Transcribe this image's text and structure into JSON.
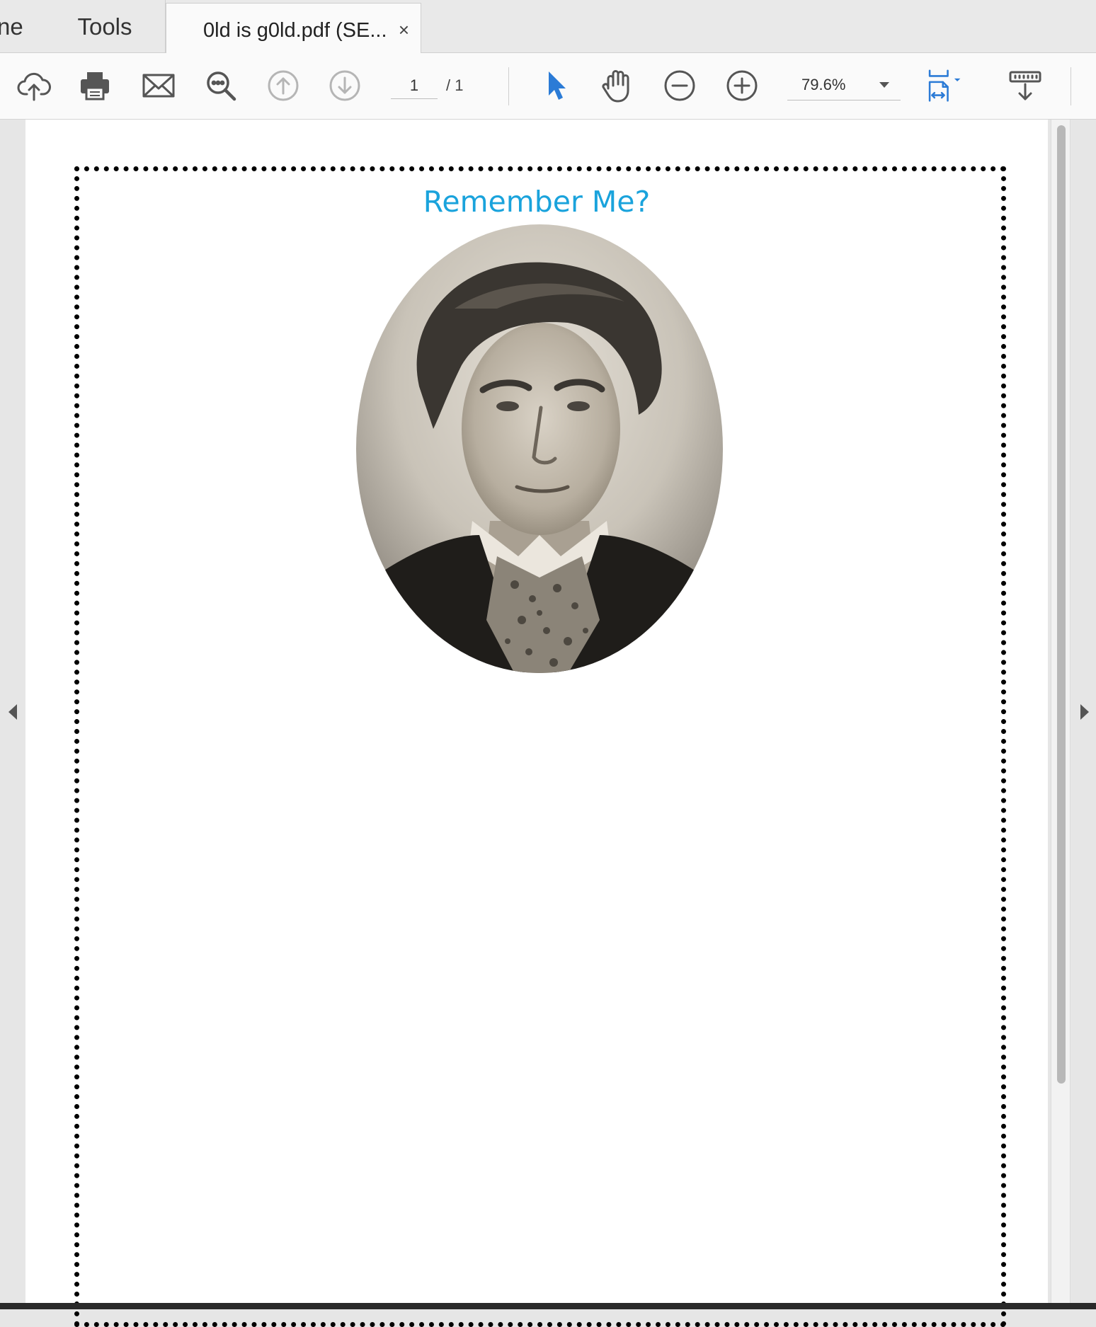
{
  "tabs": {
    "home_label": "ne",
    "tools_label": "Tools",
    "document_title": "0ld is g0ld.pdf (SE...",
    "close_symbol": "×"
  },
  "toolbar": {
    "icons": [
      "cloud-upload-icon",
      "print-icon",
      "mail-icon",
      "search-icon",
      "previous-page-icon",
      "next-page-icon",
      "select-cursor-icon",
      "hand-icon",
      "zoom-out-icon",
      "zoom-in-icon",
      "fit-page-icon",
      "scrolling-mode-icon"
    ],
    "current_page": "1",
    "total_pages": "/ 1",
    "zoom_value": "79.6%",
    "accent_color": "#2b7bd6"
  },
  "document": {
    "heading": "Remember Me?",
    "heading_color": "#1aa3dc",
    "image": "portrait-photograph"
  }
}
